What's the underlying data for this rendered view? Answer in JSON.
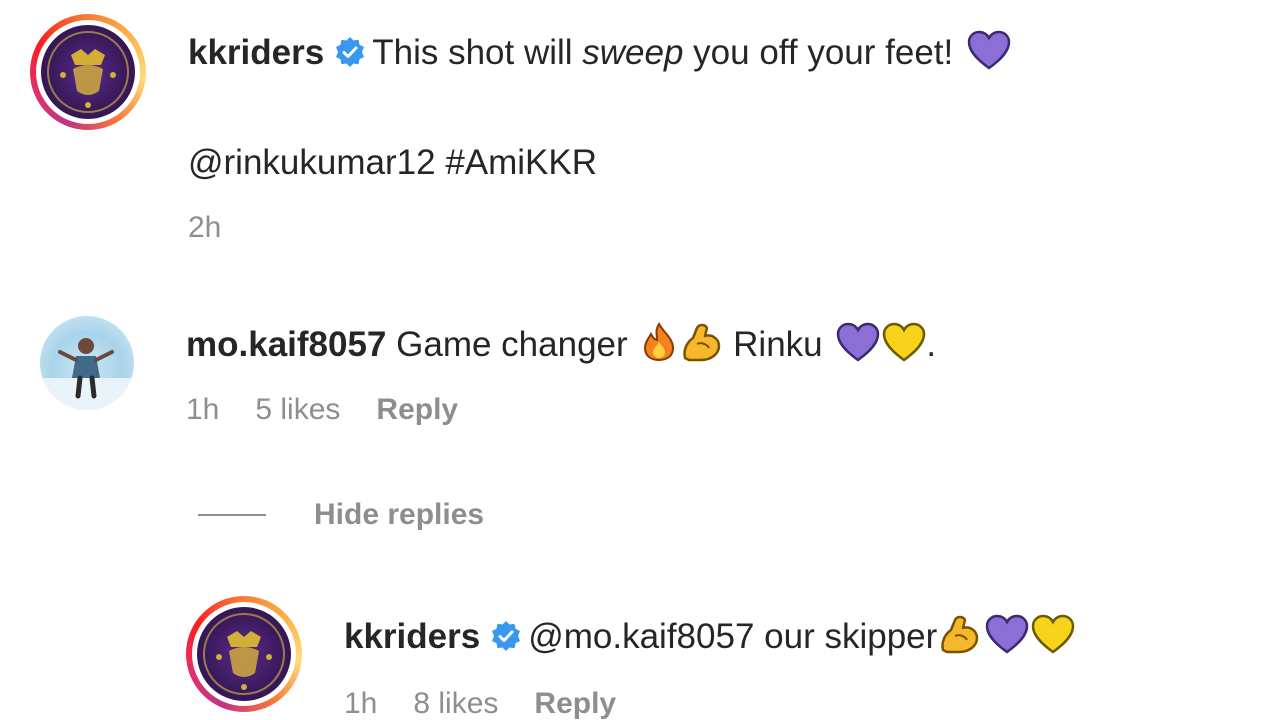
{
  "caption": {
    "username": "kkriders",
    "verified": true,
    "text_before": "This shot will ",
    "text_italic": "sweep",
    "text_after": " you off your feet!",
    "emoji": "purple-heart",
    "mention": "@rinkukumar12",
    "hashtag": "#AmiKKR",
    "time": "2h"
  },
  "comment": {
    "username": "mo.kaif8057",
    "text_before": "Game changer",
    "text_middle": "Rinku",
    "text_end": ".",
    "emojis_1": [
      "fire",
      "flexed-biceps"
    ],
    "emojis_2": [
      "purple-heart",
      "yellow-heart"
    ],
    "time": "1h",
    "likes": "5 likes",
    "reply_label": "Reply"
  },
  "hide_replies_label": "Hide replies",
  "reply": {
    "username": "kkriders",
    "verified": true,
    "mention": "@mo.kaif8057",
    "text": "our skipper",
    "emojis": [
      "flexed-biceps",
      "purple-heart",
      "yellow-heart"
    ],
    "time": "1h",
    "likes": "8 likes",
    "reply_label": "Reply"
  },
  "colors": {
    "text": "#262626",
    "meta": "#8e8e8e",
    "verified": "#3897f0",
    "purple_heart": "#8b6fd6",
    "yellow_heart": "#f7d31c"
  }
}
